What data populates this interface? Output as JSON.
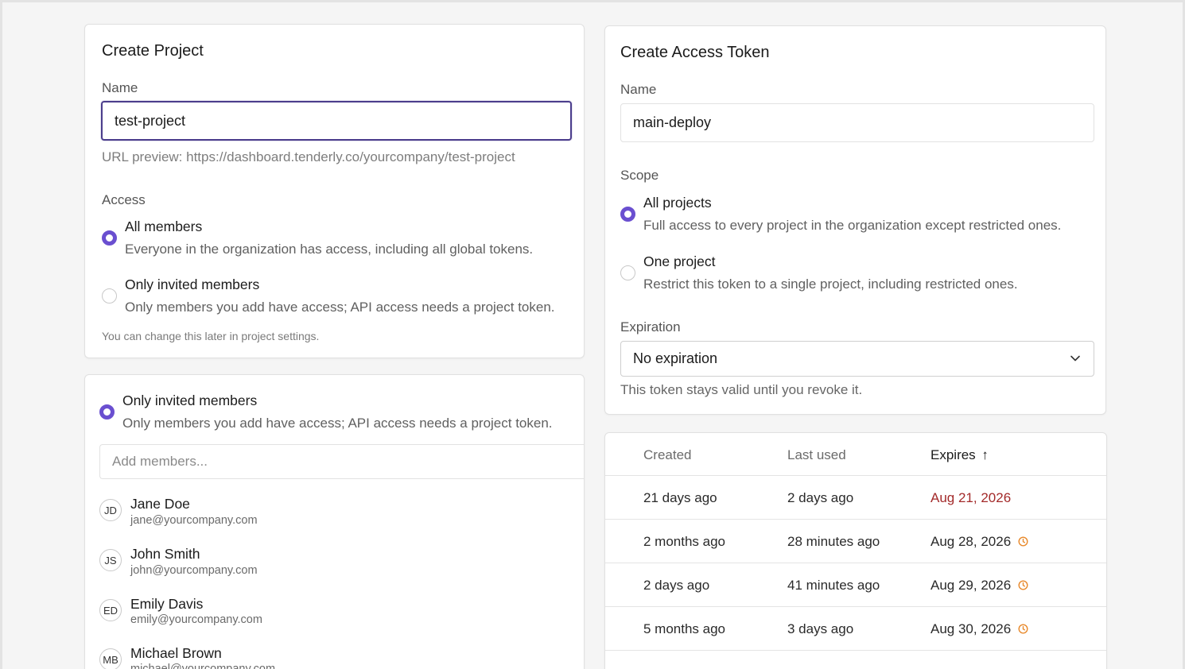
{
  "create_project": {
    "title": "Create Project",
    "name_label": "Name",
    "name_value": "test-project",
    "url_preview": "URL preview: https://dashboard.tenderly.co/yourcompany/test-project",
    "access_label": "Access",
    "options": [
      {
        "title": "All members",
        "desc": "Everyone in the organization has access, including all global tokens.",
        "checked": true
      },
      {
        "title": "Only invited members",
        "desc": "Only members you add have access; API access needs a project token.",
        "checked": false
      }
    ],
    "footer_hint": "You can change this later in project settings."
  },
  "invite_panel": {
    "option_title": "Only invited members",
    "option_desc": "Only members you add have access; API access needs a project token.",
    "add_placeholder": "Add members...",
    "members": [
      {
        "initials": "JD",
        "name": "Jane Doe",
        "email": "jane@yourcompany.com"
      },
      {
        "initials": "JS",
        "name": "John Smith",
        "email": "john@yourcompany.com"
      },
      {
        "initials": "ED",
        "name": "Emily Davis",
        "email": "emily@yourcompany.com"
      },
      {
        "initials": "MB",
        "name": "Michael Brown",
        "email": "michael@yourcompany.com"
      }
    ]
  },
  "create_token": {
    "title": "Create Access Token",
    "name_label": "Name",
    "name_value": "main-deploy",
    "scope_label": "Scope",
    "scopes": [
      {
        "title": "All projects",
        "desc": "Full access to every project in the organization except restricted ones.",
        "checked": true
      },
      {
        "title": "One project",
        "desc": "Restrict this token to a single project, including restricted ones.",
        "checked": false
      }
    ],
    "expiration_label": "Expiration",
    "expiration_value": "No expiration",
    "expiration_hint": "This token stays valid until you revoke it."
  },
  "tokens_table": {
    "headers": {
      "created": "Created",
      "last_used": "Last used",
      "expires": "Expires",
      "sort_arrow": "↑"
    },
    "rows": [
      {
        "created": "21 days ago",
        "last_used": "2 days ago",
        "expires": "Aug 21, 2026",
        "status": "expired"
      },
      {
        "created": "2 months ago",
        "last_used": "28 minutes ago",
        "expires": "Aug 28, 2026",
        "status": "expiring"
      },
      {
        "created": "2 days ago",
        "last_used": "41 minutes ago",
        "expires": "Aug 29, 2026",
        "status": "expiring"
      },
      {
        "created": "5 months ago",
        "last_used": "3 days ago",
        "expires": "Aug 30, 2026",
        "status": "expiring"
      }
    ]
  },
  "colors": {
    "accent": "#6a4fd0",
    "expired": "#a32a2a",
    "warning": "#e8892b"
  }
}
